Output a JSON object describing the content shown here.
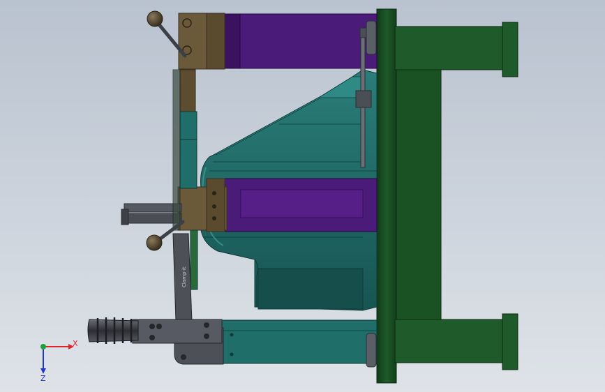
{
  "colors": {
    "background_top": "#b9c2cf",
    "background_bottom": "#dfe3e8",
    "base_plate": "#1f5a2a",
    "base_plate_dark": "#0f3a16",
    "mold_body": "#1f6e6a",
    "mold_body_dark": "#124845",
    "purple_block": "#4a1b78",
    "brown_bracket": "#6b5a3a",
    "steel": "#4d5057",
    "knob": "#4a3f2e",
    "axis_x": "#d9262b",
    "axis_y": "#1aa33b",
    "axis_z": "#2238c8"
  },
  "icons": {
    "triad": "coordinate-triad-icon"
  },
  "triad": {
    "x_label": "X",
    "z_label": "Z"
  },
  "clamp_brand": "Clamp-it"
}
